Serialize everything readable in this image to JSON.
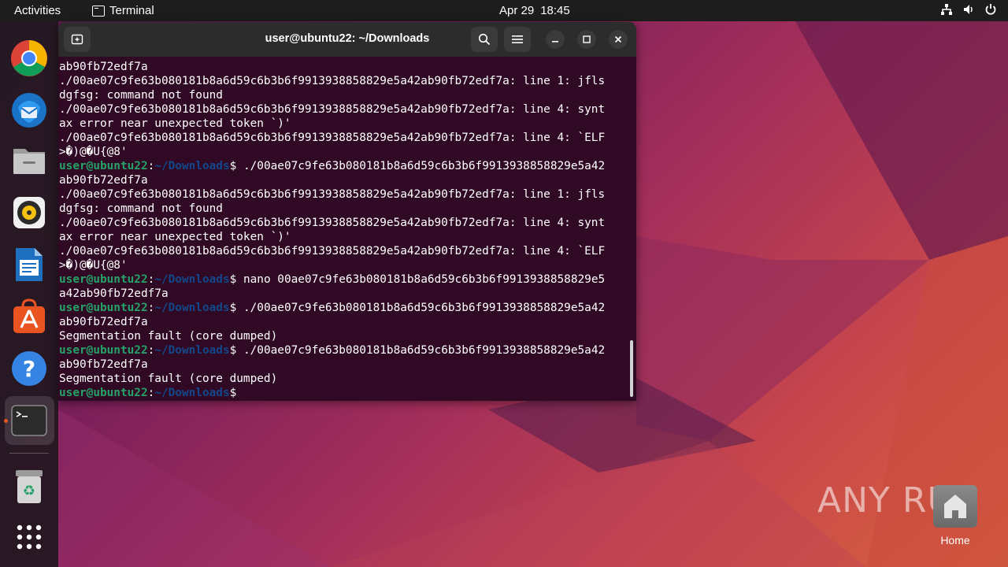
{
  "topbar": {
    "activities": "Activities",
    "app_name": "Terminal",
    "date": "Apr 29",
    "time": "18:45"
  },
  "dock": {
    "items": [
      {
        "name": "Google Chrome",
        "icon": "chrome-icon"
      },
      {
        "name": "Thunderbird Mail",
        "icon": "thunderbird-icon"
      },
      {
        "name": "Files",
        "icon": "files-icon"
      },
      {
        "name": "Rhythmbox",
        "icon": "rhythmbox-icon"
      },
      {
        "name": "LibreOffice Writer",
        "icon": "writer-icon"
      },
      {
        "name": "Ubuntu Software",
        "icon": "software-icon"
      },
      {
        "name": "Help",
        "icon": "help-icon"
      },
      {
        "name": "Terminal",
        "icon": "terminal-icon"
      },
      {
        "name": "Trash",
        "icon": "trash-icon"
      },
      {
        "name": "Show Applications",
        "icon": "app-grid-icon"
      }
    ]
  },
  "terminal": {
    "title": "user@ubuntu22: ~/Downloads",
    "prompt_user": "user@ubuntu22",
    "prompt_sep": ":",
    "prompt_path": "~/Downloads",
    "prompt_dollar": "$",
    "lines": [
      {
        "type": "out",
        "text": "ab90fb72edf7a"
      },
      {
        "type": "out",
        "text": "./00ae07c9fe63b080181b8a6d59c6b3b6f9913938858829e5a42ab90fb72edf7a: line 1: jfls"
      },
      {
        "type": "out",
        "text": "dgfsg: command not found"
      },
      {
        "type": "out",
        "text": "./00ae07c9fe63b080181b8a6d59c6b3b6f9913938858829e5a42ab90fb72edf7a: line 4: synt"
      },
      {
        "type": "out",
        "text": "ax error near unexpected token `)'"
      },
      {
        "type": "out",
        "text": "./00ae07c9fe63b080181b8a6d59c6b3b6f9913938858829e5a42ab90fb72edf7a: line 4: `ELF"
      },
      {
        "type": "out",
        "text": ">�)@�U{@8'"
      },
      {
        "type": "prompt",
        "text": " ./00ae07c9fe63b080181b8a6d59c6b3b6f9913938858829e5a42"
      },
      {
        "type": "out",
        "text": "ab90fb72edf7a"
      },
      {
        "type": "out",
        "text": "./00ae07c9fe63b080181b8a6d59c6b3b6f9913938858829e5a42ab90fb72edf7a: line 1: jfls"
      },
      {
        "type": "out",
        "text": "dgfsg: command not found"
      },
      {
        "type": "out",
        "text": "./00ae07c9fe63b080181b8a6d59c6b3b6f9913938858829e5a42ab90fb72edf7a: line 4: synt"
      },
      {
        "type": "out",
        "text": "ax error near unexpected token `)'"
      },
      {
        "type": "out",
        "text": "./00ae07c9fe63b080181b8a6d59c6b3b6f9913938858829e5a42ab90fb72edf7a: line 4: `ELF"
      },
      {
        "type": "out",
        "text": ">�)@�U{@8'"
      },
      {
        "type": "prompt",
        "text": " nano 00ae07c9fe63b080181b8a6d59c6b3b6f9913938858829e5"
      },
      {
        "type": "out",
        "text": "a42ab90fb72edf7a"
      },
      {
        "type": "prompt",
        "text": " ./00ae07c9fe63b080181b8a6d59c6b3b6f9913938858829e5a42"
      },
      {
        "type": "out",
        "text": "ab90fb72edf7a"
      },
      {
        "type": "out",
        "text": "Segmentation fault (core dumped)"
      },
      {
        "type": "prompt",
        "text": " ./00ae07c9fe63b080181b8a6d59c6b3b6f9913938858829e5a42"
      },
      {
        "type": "out",
        "text": "ab90fb72edf7a"
      },
      {
        "type": "out",
        "text": "Segmentation fault (core dumped)"
      },
      {
        "type": "prompt",
        "text": ""
      }
    ]
  },
  "desktop": {
    "home_label": "Home",
    "watermark": "ANY RUN"
  },
  "colors": {
    "terminal_bg": "#300a24",
    "prompt_user": "#26a269",
    "prompt_path": "#12488b",
    "accent": "#e95420"
  }
}
